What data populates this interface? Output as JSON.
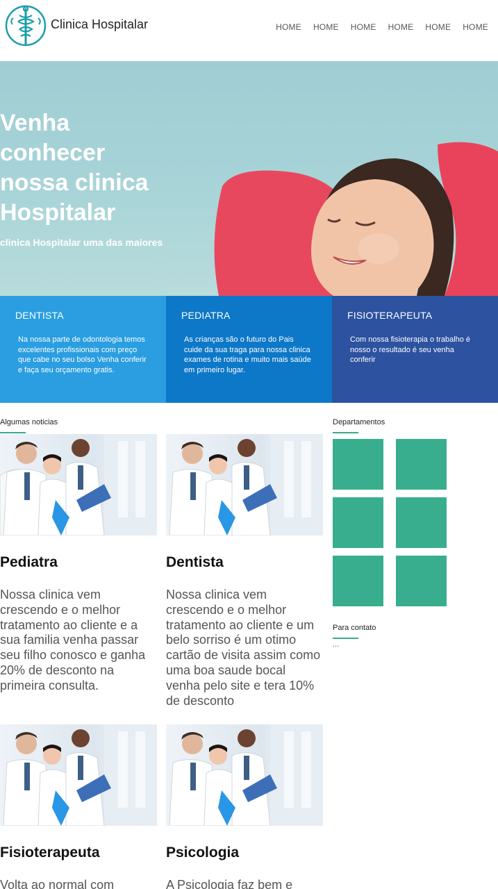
{
  "header": {
    "brand": "Clinica Hospitalar",
    "nav": [
      "HOME",
      "HOME",
      "HOME",
      "HOME",
      "HOME",
      "HOME"
    ]
  },
  "hero": {
    "title": "Venha conhecer nossa clinica Hospitalar",
    "subtitle": "clinica Hospitalar uma das maiores"
  },
  "services": [
    {
      "title": "DENTISTA",
      "text": "Na nossa parte de odontologia temos excelentes profissionais com preço que cabe no seu bolso Venha conferir e faça seu orçamento gratis."
    },
    {
      "title": "PEDIATRA",
      "text": "As crianças são o futuro do Pais cuide da sua traga para nossa clinica exames de rotina e muito mais saúde em primeiro lugar."
    },
    {
      "title": "FISIOTERAPEUTA",
      "text": "Com nossa fisioterapia o trabalho é nosso o resultado é seu venha conferir"
    }
  ],
  "news": {
    "label": "Algumas noticias",
    "items": [
      {
        "title": "Pediatra",
        "text": "Nossa clinica vem crescendo e o melhor tratamento ao cliente e a sua familia venha passar seu filho conosco e ganha 20% de desconto na primeira consulta."
      },
      {
        "title": "Dentista",
        "text": "Nossa clinica vem crescendo e o melhor tratamento ao cliente e um belo sorriso é um otimo cartão de visita assim como uma boa saude bocal venha pelo site e tera 10% de desconto"
      },
      {
        "title": "Fisioterapeuta",
        "text": "Volta ao normal com"
      },
      {
        "title": "Psicologia",
        "text": "A Psicologia faz bem e"
      }
    ]
  },
  "sidebar": {
    "departments_label": "Departamentos",
    "contact_label": "Para contato",
    "contact_text": "..."
  },
  "colors": {
    "accent_green": "#38ae8e",
    "service_1": "#2a9ee0",
    "service_2": "#0e78c8",
    "service_3": "#2c52a0"
  }
}
